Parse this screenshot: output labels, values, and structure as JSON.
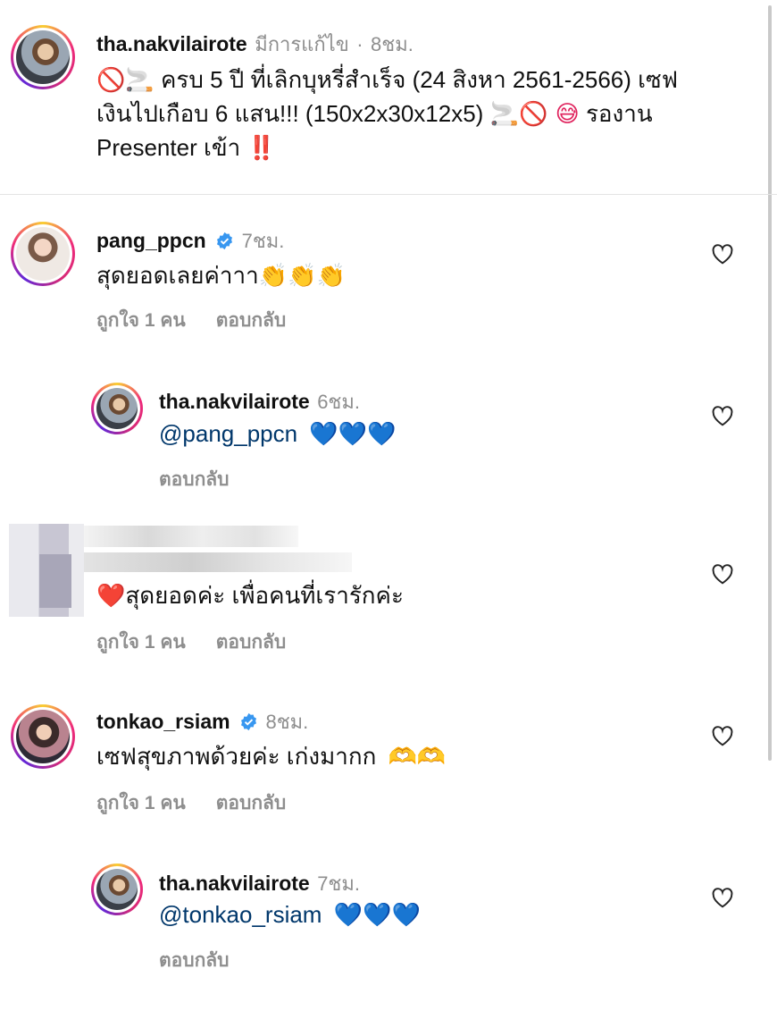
{
  "post": {
    "username": "tha.nakvilairote",
    "edited_label": "มีการแก้ไข",
    "dot": "·",
    "time": "8ชม.",
    "emoji_start": "🚫🚬",
    "line1": "ครบ 5 ปี ที่เลิกบุหรี่สำเร็จ (24 สิงหา 2561-2566) เซฟ",
    "line2_text": "เงินไปเกือบ 6 แสน!!! (150x2x30x12x5)",
    "line2_emoji": "🚬🚫 😅",
    "line2_end": "รองาน",
    "line3_text": "Presenter เข้า",
    "line3_emoji": "‼️"
  },
  "comments": [
    {
      "username": "pang_ppcn",
      "verified": true,
      "time": "7ชม.",
      "text": "สุดยอดเลยค่าาา",
      "emoji": "👏👏👏",
      "likes_label": "ถูกใจ 1 คน",
      "reply_label": "ตอบกลับ"
    },
    {
      "username": "tha.nakvilairote",
      "time": "6ชม.",
      "mention": "@pang_ppcn",
      "emoji": "💙💙💙",
      "reply_label": "ตอบกลับ"
    },
    {
      "emoji": "❤️",
      "text": "สุดยอดค่ะ เพื่อคนที่เรารักค่ะ",
      "likes_label": "ถูกใจ 1 คน",
      "reply_label": "ตอบกลับ"
    },
    {
      "username": "tonkao_rsiam",
      "verified": true,
      "time": "8ชม.",
      "text": "เซฟสุขภาพด้วยค่ะ เก่งมากก",
      "emoji": "🫶🫶",
      "likes_label": "ถูกใจ 1 คน",
      "reply_label": "ตอบกลับ"
    },
    {
      "username": "tha.nakvilairote",
      "time": "7ชม.",
      "mention": "@tonkao_rsiam",
      "emoji": "💙💙💙",
      "reply_label": "ตอบกลับ"
    }
  ],
  "icons": {
    "like": "heart-outline-icon",
    "verified": "verified-badge-icon"
  },
  "colors": {
    "verified_blue": "#3897f0",
    "mention": "#00376b",
    "meta_gray": "#8e8e8e"
  }
}
